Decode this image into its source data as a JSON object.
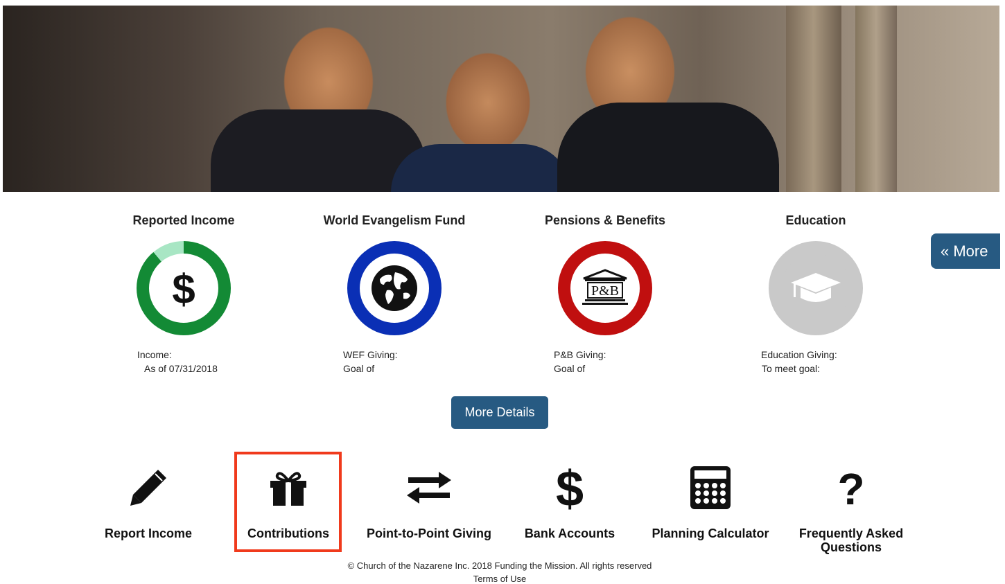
{
  "stats": [
    {
      "title": "Reported Income",
      "line1": "Income:",
      "line2": "As of 07/31/2018",
      "icon": "dollar-icon"
    },
    {
      "title": "World Evangelism Fund",
      "line1": "WEF Giving:",
      "line2": "Goal of",
      "icon": "globe-icon"
    },
    {
      "title": "Pensions & Benefits",
      "line1": "P&B Giving:",
      "line2": "Goal of",
      "icon": "pension-building-icon",
      "badge_text": "P&B"
    },
    {
      "title": "Education",
      "line1": "Education Giving:",
      "line2": "To meet goal:",
      "icon": "graduation-cap-icon"
    }
  ],
  "colors": {
    "income_ring": "#138a35",
    "income_ring_light": "#a8e6c4",
    "wef_ring": "#0a2fb5",
    "pb_ring": "#c00f0f",
    "edu_ring": "#c9c9c9",
    "button_blue": "#275a82",
    "highlight_red": "#f03a1c"
  },
  "more_tab": {
    "label": "« More"
  },
  "details_button": {
    "label": "More Details"
  },
  "tiles": [
    {
      "label": "Report Income",
      "icon": "pencil-icon"
    },
    {
      "label": "Contributions",
      "icon": "gift-icon"
    },
    {
      "label": "Point-to-Point Giving",
      "icon": "exchange-arrows-icon"
    },
    {
      "label": "Bank Accounts",
      "icon": "dollar-sign-icon"
    },
    {
      "label": "Planning Calculator",
      "icon": "calculator-icon"
    },
    {
      "label": "Frequently Asked Questions",
      "icon": "question-icon"
    }
  ],
  "footer": {
    "copyright": "© Church of the Nazarene Inc. 2018 Funding the Mission. All rights reserved",
    "terms": "Terms of Use"
  }
}
